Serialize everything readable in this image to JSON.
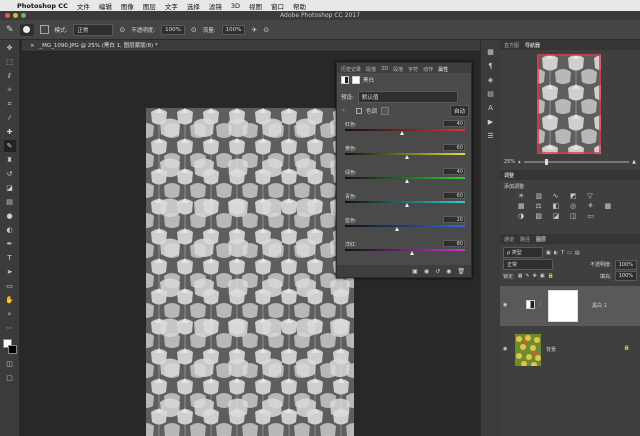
{
  "menubar": {
    "apple": "",
    "app_name": "Photoshop CC",
    "items": [
      "文件",
      "编辑",
      "图像",
      "图层",
      "文字",
      "选择",
      "滤镜",
      "3D",
      "视图",
      "窗口",
      "帮助"
    ]
  },
  "window": {
    "title": "Adobe Photoshop CC 2017"
  },
  "options_bar": {
    "mode_label": "模式:",
    "mode_value": "正常",
    "opacity_label": "不透明度:",
    "opacity_value": "100%",
    "flow_label": "流量:",
    "flow_value": "100%"
  },
  "document": {
    "tab_title": "_MG_1090.JPG @ 25% (黑白 1, 图层蒙版/8) *"
  },
  "bw_panel": {
    "tabs": [
      "历史记录",
      "段落",
      "3D",
      "段落",
      "字符",
      "动作",
      "属性"
    ],
    "active_tab": "属性",
    "header": "黑白",
    "preset_label": "预设:",
    "preset_value": "默认值",
    "tint_label": "色调",
    "auto_label": "自动",
    "sliders": [
      {
        "label": "红色:",
        "value": "40",
        "pos": 0.48
      },
      {
        "label": "黄色:",
        "value": "60",
        "pos": 0.52
      },
      {
        "label": "绿色:",
        "value": "40",
        "pos": 0.52
      },
      {
        "label": "青色:",
        "value": "60",
        "pos": 0.52
      },
      {
        "label": "蓝色:",
        "value": "20",
        "pos": 0.44
      },
      {
        "label": "洋红:",
        "value": "80",
        "pos": 0.56
      }
    ]
  },
  "navigator": {
    "tabs": [
      "直方图",
      "导航器"
    ],
    "active_tab": "导航器",
    "zoom": "25%"
  },
  "adjustments": {
    "tabs": [
      "调整"
    ],
    "add_label": "添加调整"
  },
  "layers": {
    "tabs": [
      "通道",
      "路径",
      "图层"
    ],
    "active_tab": "图层",
    "kind_label": "ρ 类型",
    "blend_mode": "正常",
    "opacity_label": "不透明度:",
    "opacity_value": "100%",
    "lock_label": "锁定:",
    "fill_label": "填充:",
    "fill_value": "100%",
    "items": [
      {
        "name": "黑白 1",
        "selected": true
      },
      {
        "name": "背景",
        "selected": false
      }
    ]
  },
  "colors": {
    "menubar_bg": "#e8e8e8",
    "panel_bg": "#4a4a4a",
    "selected_layer": "#595959",
    "nav_frame": "#e0334a"
  }
}
